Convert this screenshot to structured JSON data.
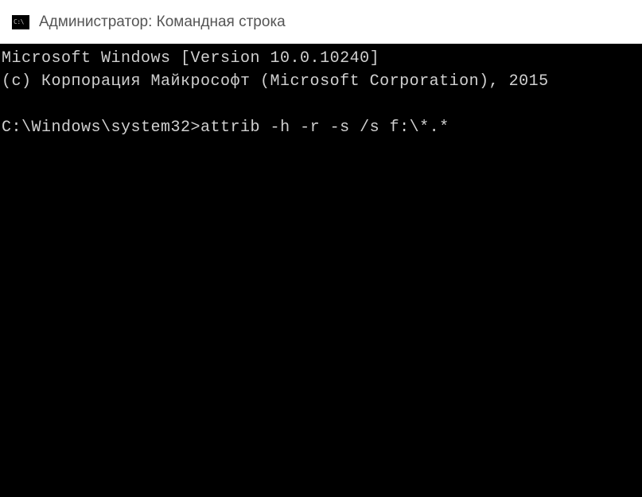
{
  "window": {
    "icon_label": "C:\\",
    "title": "Администратор: Командная строка"
  },
  "terminal": {
    "line1": "Microsoft Windows [Version 10.0.10240]",
    "line2": "(c) Корпорация Майкрософт (Microsoft Corporation), 2015",
    "blank": "",
    "prompt": "C:\\Windows\\system32>",
    "command": "attrib -h -r -s /s f:\\*.*"
  }
}
